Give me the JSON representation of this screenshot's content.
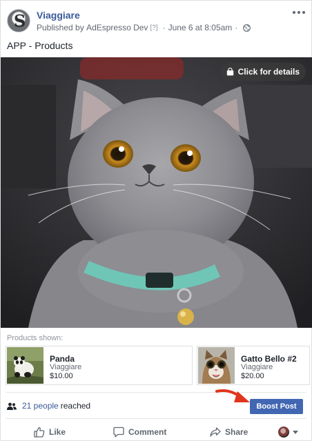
{
  "post": {
    "page_name": "Viaggiare",
    "published_by_prefix": "Published by",
    "published_by": "AdEspresso Dev",
    "help_marker": "[?]",
    "separator": "·",
    "date": "June 6 at 8:05am",
    "privacy_icon": "globe-icon",
    "text": "APP - Products"
  },
  "media": {
    "details_label": "Click for details",
    "details_icon": "shopping-bag-icon"
  },
  "products": {
    "label": "Products shown:",
    "items": [
      {
        "name": "Panda",
        "seller": "Viaggiare",
        "price": "$10.00"
      },
      {
        "name": "Gatto Bello #2",
        "seller": "Viaggiare",
        "price": "$20.00"
      }
    ]
  },
  "reach": {
    "count_text": "21 people",
    "suffix": "reached",
    "boost_label": "Boost Post",
    "people_icon": "people-icon",
    "arrow_color": "#e0351c"
  },
  "actions": {
    "like": "Like",
    "comment": "Comment",
    "share": "Share"
  },
  "colors": {
    "brand_blue": "#385898",
    "button_blue": "#4267b2",
    "secondary_text": "#606770"
  }
}
